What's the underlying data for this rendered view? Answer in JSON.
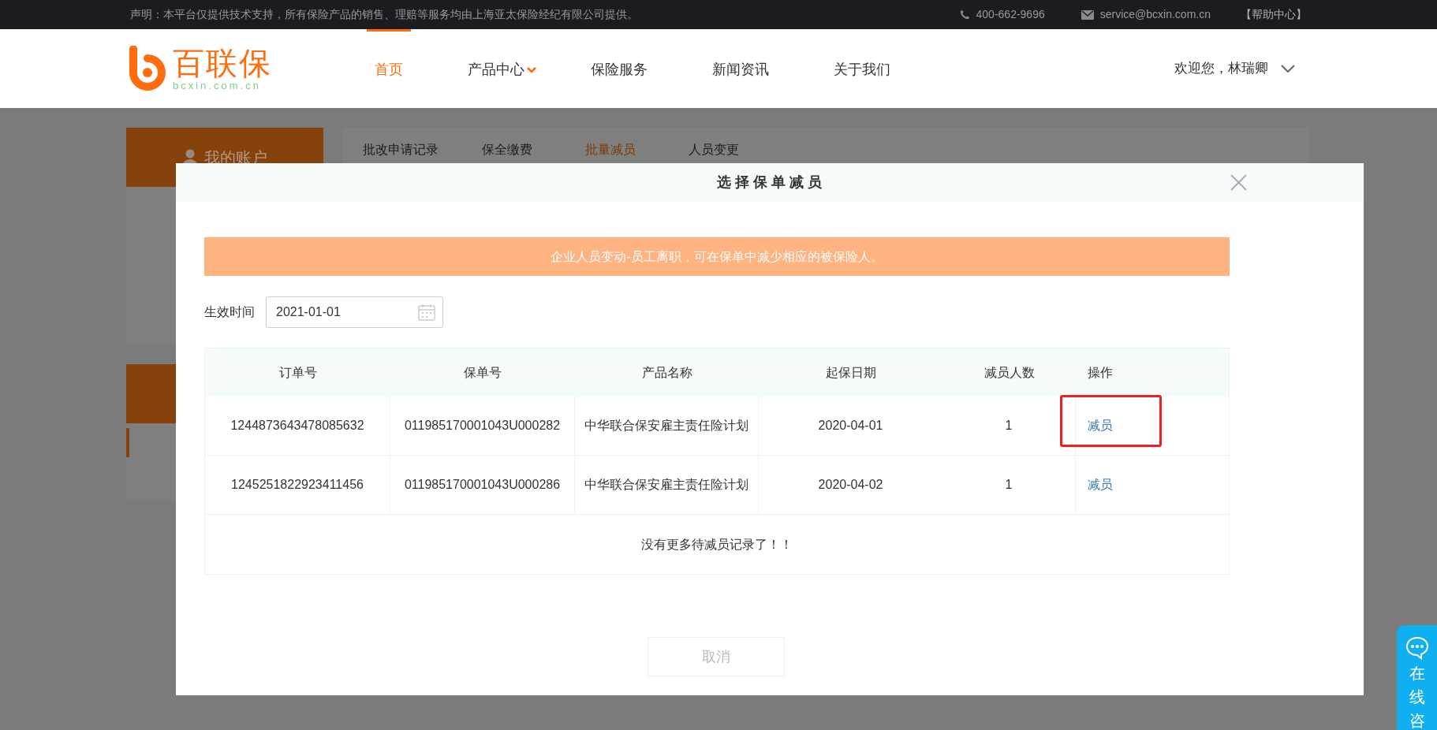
{
  "top_bar": {
    "notice": "声明：本平台仅提供技术支持，所有保险产品的销售、理赔等服务均由上海亚太保险经纪有限公司提供。",
    "phone": "400-662-9696",
    "email": "service@bcxin.com.cn",
    "help": "【帮助中心】"
  },
  "header": {
    "logo": {
      "name": "百联保",
      "domain": "bcxin.com.cn"
    },
    "nav": [
      {
        "label": "首页",
        "selected": true,
        "has_dropdown": false
      },
      {
        "label": "产品中心",
        "selected": false,
        "has_dropdown": true
      },
      {
        "label": "保险服务",
        "selected": false,
        "has_dropdown": false
      },
      {
        "label": "新闻资讯",
        "selected": false,
        "has_dropdown": false
      },
      {
        "label": "关于我们",
        "selected": false,
        "has_dropdown": false
      }
    ],
    "user": {
      "greeting": "欢迎您，林瑞卿"
    }
  },
  "sidebar": {
    "title": "我的账户"
  },
  "tabs": [
    {
      "label": "批改申请记录",
      "selected": false
    },
    {
      "label": "保全缴费",
      "selected": false
    },
    {
      "label": "批量减员",
      "selected": true
    },
    {
      "label": "人员变更",
      "selected": false
    }
  ],
  "modal": {
    "title": "选 择 保 单 减 员",
    "alert": "企业人员变动-员工离职，可在保单中减少相应的被保险人。",
    "date_field": {
      "label": "生效时间",
      "value": "2021-01-01"
    },
    "table": {
      "columns": [
        "订单号",
        "保单号",
        "产品名称",
        "起保日期",
        "减员人数",
        "操作"
      ],
      "rows": [
        {
          "cells": [
            "1244873643478085632",
            "011985170001043U000282",
            "中华联合保安雇主责任险计划",
            "2020-04-01",
            "1"
          ],
          "action": "减员",
          "highlighted": true
        },
        {
          "cells": [
            "1245251822923411456",
            "011985170001043U000286",
            "中华联合保安雇主责任险计划",
            "2020-04-02",
            "1"
          ],
          "action": "减员",
          "highlighted": false
        }
      ],
      "footer": "没有更多待减员记录了！！"
    },
    "cancel": "取消"
  },
  "chat": {
    "label": "在线咨"
  }
}
